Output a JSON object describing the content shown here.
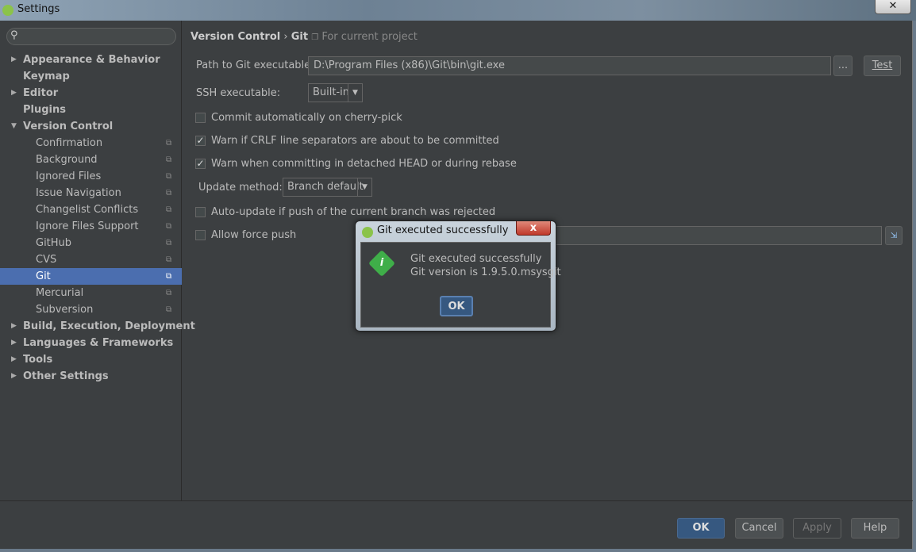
{
  "window": {
    "title": "Settings",
    "close": "✕"
  },
  "search": {
    "placeholder": "",
    "icon": "search-icon"
  },
  "tree": [
    {
      "label": "Appearance & Behavior",
      "level": 0,
      "arrow": "▶"
    },
    {
      "label": "Keymap",
      "level": 0
    },
    {
      "label": "Editor",
      "level": 0,
      "arrow": "▶"
    },
    {
      "label": "Plugins",
      "level": 0
    },
    {
      "label": "Version Control",
      "level": 0,
      "arrow": "▼"
    },
    {
      "label": "Confirmation",
      "level": 1,
      "project": true
    },
    {
      "label": "Background",
      "level": 1,
      "project": true
    },
    {
      "label": "Ignored Files",
      "level": 1,
      "project": true
    },
    {
      "label": "Issue Navigation",
      "level": 1,
      "project": true
    },
    {
      "label": "Changelist Conflicts",
      "level": 1,
      "project": true
    },
    {
      "label": "Ignore Files Support",
      "level": 1,
      "project": true
    },
    {
      "label": "GitHub",
      "level": 1,
      "project": true
    },
    {
      "label": "CVS",
      "level": 1,
      "project": true
    },
    {
      "label": "Git",
      "level": 1,
      "project": true,
      "selected": true
    },
    {
      "label": "Mercurial",
      "level": 1,
      "project": true
    },
    {
      "label": "Subversion",
      "level": 1,
      "project": true
    },
    {
      "label": "Build, Execution, Deployment",
      "level": 0,
      "arrow": "▶"
    },
    {
      "label": "Languages & Frameworks",
      "level": 0,
      "arrow": "▶"
    },
    {
      "label": "Tools",
      "level": 0,
      "arrow": "▶"
    },
    {
      "label": "Other Settings",
      "level": 0,
      "arrow": "▶"
    }
  ],
  "breadcrumb": {
    "parent": "Version Control",
    "sep": "›",
    "current": "Git",
    "scope": "For current project"
  },
  "git": {
    "path_label": "Path to Git executable:",
    "path_value": "D:\\Program Files (x86)\\Git\\bin\\git.exe",
    "browse": "...",
    "test": "Test",
    "ssh_label": "SSH executable:",
    "ssh_value": "Built-in",
    "checkboxes": [
      {
        "label": "Commit automatically on cherry-pick",
        "checked": false
      },
      {
        "label": "Warn if CRLF line separators are about to be committed",
        "checked": true
      },
      {
        "label": "Warn when committing in detached HEAD or during rebase",
        "checked": true
      }
    ],
    "update_label": "Update method:",
    "update_value": "Branch default",
    "auto_update": {
      "label": "Auto-update if push of the current branch was rejected",
      "checked": false
    },
    "force_push": {
      "label": "Allow force push",
      "checked": false
    }
  },
  "dialog": {
    "title": "Git executed successfully",
    "line1": "Git executed successfully",
    "line2": "Git version is 1.9.5.0.msysgit",
    "ok": "OK",
    "close": "x"
  },
  "footer": {
    "ok": "OK",
    "cancel": "Cancel",
    "apply": "Apply",
    "help": "Help"
  },
  "colors": {
    "selection": "#4b6eaf",
    "background": "#3c3f41",
    "primary_button": "#365880"
  }
}
